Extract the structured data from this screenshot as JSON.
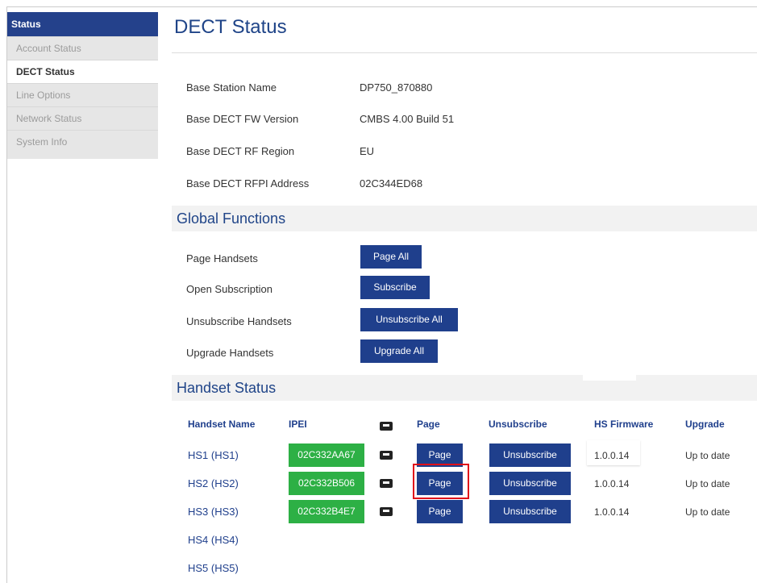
{
  "sidebar": {
    "header": "Status",
    "items": [
      {
        "label": "Account Status"
      },
      {
        "label": "DECT Status"
      },
      {
        "label": "Line Options"
      },
      {
        "label": "Network Status"
      },
      {
        "label": "System Info"
      }
    ]
  },
  "page": {
    "title": "DECT Status"
  },
  "base_info": [
    {
      "label": "Base Station Name",
      "value": "DP750_870880"
    },
    {
      "label": "Base DECT FW Version",
      "value": "CMBS 4.00 Build 51"
    },
    {
      "label": "Base DECT RF Region",
      "value": "EU"
    },
    {
      "label": "Base DECT RFPI Address",
      "value": "02C344ED68"
    }
  ],
  "global_functions": {
    "title": "Global Functions",
    "rows": [
      {
        "label": "Page Handsets",
        "button": "Page All"
      },
      {
        "label": "Open Subscription",
        "button": "Subscribe"
      },
      {
        "label": "Unsubscribe Handsets",
        "button": "Unsubscribe All"
      },
      {
        "label": "Upgrade Handsets",
        "button": "Upgrade All"
      }
    ]
  },
  "handset_status": {
    "title": "Handset Status",
    "columns": [
      "Handset Name",
      "IPEI",
      "Page",
      "Unsubscribe",
      "HS Firmware",
      "Upgrade"
    ],
    "rows": [
      {
        "name": "HS1 (HS1)",
        "ipei": "02C332AA67",
        "page": "Page",
        "unsubscribe": "Unsubscribe",
        "firmware": "1.0.0.14",
        "upgrade": "Up to date"
      },
      {
        "name": "HS2 (HS2)",
        "ipei": "02C332B506",
        "page": "Page",
        "unsubscribe": "Unsubscribe",
        "firmware": "1.0.0.14",
        "upgrade": "Up to date"
      },
      {
        "name": "HS3 (HS3)",
        "ipei": "02C332B4E7",
        "page": "Page",
        "unsubscribe": "Unsubscribe",
        "firmware": "1.0.0.14",
        "upgrade": "Up to date"
      },
      {
        "name": "HS4 (HS4)"
      },
      {
        "name": "HS5 (HS5)"
      }
    ]
  },
  "colors": {
    "brand": "#1f3f8c",
    "ipei": "#2db045",
    "highlight": "#e0101a"
  }
}
